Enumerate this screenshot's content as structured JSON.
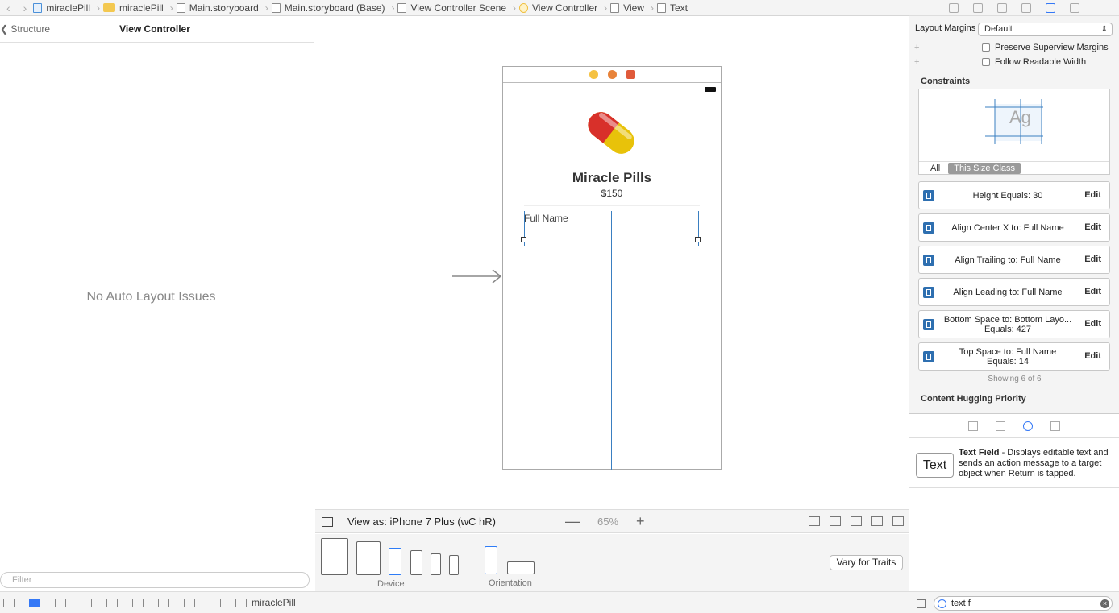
{
  "breadcrumbs": [
    "miraclePill",
    "miraclePill",
    "Main.storyboard",
    "Main.storyboard (Base)",
    "View Controller Scene",
    "View Controller",
    "View",
    "Text"
  ],
  "outline": {
    "back_label": "Structure",
    "title": "View Controller",
    "issues": "No Auto Layout Issues",
    "filter_placeholder": "Filter"
  },
  "scene": {
    "app_title": "Miracle Pills",
    "price": "$150",
    "field_placeholder": "Full Name"
  },
  "canvas_bar": {
    "view_as": "View as: iPhone 7 Plus (wC hR)",
    "zoom": "65%",
    "minus": "—",
    "plus": "+"
  },
  "devices": {
    "device_label": "Device",
    "orientation_label": "Orientation",
    "vary_button": "Vary for Traits"
  },
  "status": {
    "project": "miraclePill"
  },
  "inspector": {
    "layout_margins_label": "Layout Margins",
    "layout_margins_value": "Default",
    "preserve_label": "Preserve Superview Margins",
    "readable_label": "Follow Readable Width",
    "constraints_title": "Constraints",
    "ag_text": "Ag",
    "tab_all": "All",
    "tab_size_class": "This Size Class",
    "constraints": [
      {
        "line1": "Height Equals:  30",
        "line2": "",
        "edit": "Edit"
      },
      {
        "line1": "Align Center X to:  Full Name",
        "line2": "",
        "edit": "Edit"
      },
      {
        "line1": "Align Trailing to:  Full Name",
        "line2": "",
        "edit": "Edit"
      },
      {
        "line1": "Align Leading to:  Full Name",
        "line2": "",
        "edit": "Edit"
      },
      {
        "line1": "Bottom Space to:  Bottom Layo...",
        "line2": "Equals:  427",
        "edit": "Edit"
      },
      {
        "line1": "Top Space to:  Full Name",
        "line2": "Equals:  14",
        "edit": "Edit"
      }
    ],
    "showing": "Showing 6 of 6",
    "hugging_title": "Content Hugging Priority"
  },
  "library": {
    "icon_label": "Text",
    "item_name": "Text Field",
    "item_desc": " - Displays editable text and sends an action message to a target object when Return is tapped.",
    "search_value": "text f"
  },
  "colors": {
    "accent": "#3478f6",
    "constraint_blue": "#2e6fb0"
  }
}
